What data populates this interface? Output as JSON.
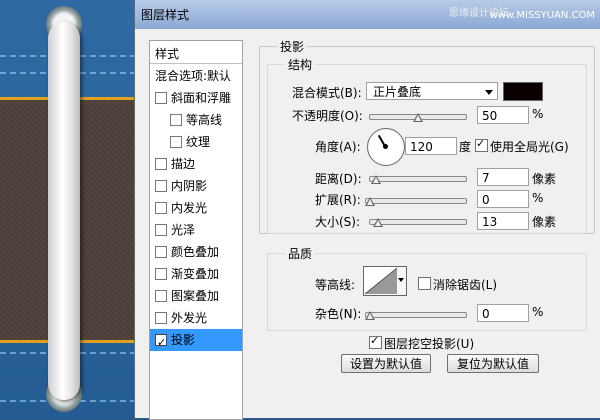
{
  "window": {
    "title": "图层样式"
  },
  "watermark": {
    "cn": "思缘设计论坛",
    "url": "www.MISSYUAN.COM"
  },
  "sidebar": {
    "header": "样式",
    "items": [
      {
        "label": "混合选项:默认",
        "checkbox": false,
        "checked": false,
        "indent": false,
        "selected": false
      },
      {
        "label": "斜面和浮雕",
        "checkbox": true,
        "checked": false,
        "indent": false,
        "selected": false
      },
      {
        "label": "等高线",
        "checkbox": true,
        "checked": false,
        "indent": true,
        "selected": false
      },
      {
        "label": "纹理",
        "checkbox": true,
        "checked": false,
        "indent": true,
        "selected": false
      },
      {
        "label": "描边",
        "checkbox": true,
        "checked": false,
        "indent": false,
        "selected": false
      },
      {
        "label": "内阴影",
        "checkbox": true,
        "checked": false,
        "indent": false,
        "selected": false
      },
      {
        "label": "内发光",
        "checkbox": true,
        "checked": false,
        "indent": false,
        "selected": false
      },
      {
        "label": "光泽",
        "checkbox": true,
        "checked": false,
        "indent": false,
        "selected": false
      },
      {
        "label": "颜色叠加",
        "checkbox": true,
        "checked": false,
        "indent": false,
        "selected": false
      },
      {
        "label": "渐变叠加",
        "checkbox": true,
        "checked": false,
        "indent": false,
        "selected": false
      },
      {
        "label": "图案叠加",
        "checkbox": true,
        "checked": false,
        "indent": false,
        "selected": false
      },
      {
        "label": "外发光",
        "checkbox": true,
        "checked": false,
        "indent": false,
        "selected": false
      },
      {
        "label": "投影",
        "checkbox": true,
        "checked": true,
        "indent": false,
        "selected": true
      }
    ]
  },
  "panel": {
    "section_title": "投影",
    "structure": {
      "title": "结构",
      "blend_mode_label": "混合模式(B):",
      "blend_mode_value": "正片叠底",
      "shadow_color": "#0a0000",
      "opacity_label": "不透明度(O):",
      "opacity_value": "50",
      "opacity_unit": "%",
      "opacity_level": 0.5,
      "angle_label": "角度(A):",
      "angle_value": "120",
      "angle_unit": "度",
      "global_light_label": "使用全局光(G)",
      "global_light_checked": true,
      "distance_label": "距离(D):",
      "distance_value": "7",
      "distance_unit": "像素",
      "spread_label": "扩展(R):",
      "spread_value": "0",
      "spread_unit": "%",
      "size_label": "大小(S):",
      "size_value": "13",
      "size_unit": "像素"
    },
    "quality": {
      "title": "品质",
      "contour_label": "等高线:",
      "antialias_label": "消除锯齿(L)",
      "antialias_checked": false,
      "noise_label": "杂色(N):",
      "noise_value": "0",
      "noise_unit": "%"
    },
    "knockout_label": "图层挖空投影(U)",
    "knockout_checked": true,
    "make_default_button": "设置为默认值",
    "reset_default_button": "复位为默认值"
  }
}
